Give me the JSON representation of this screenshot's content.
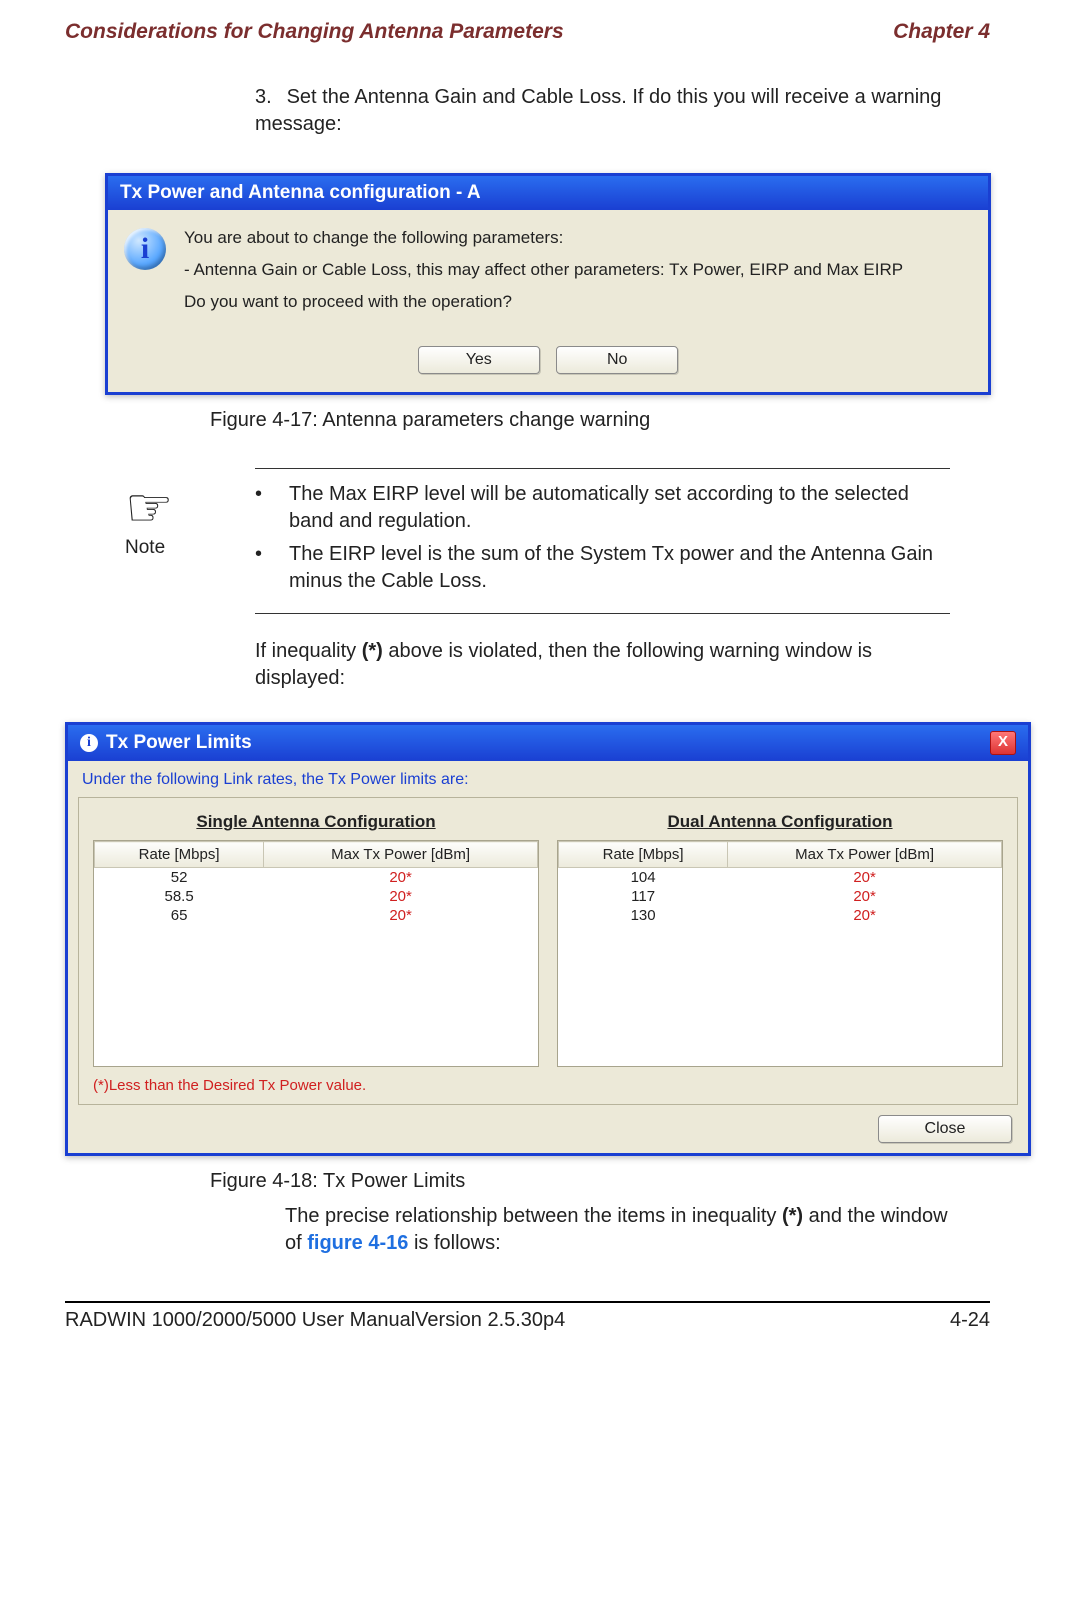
{
  "header": {
    "section_title": "Considerations for Changing Antenna Parameters",
    "chapter": "Chapter 4"
  },
  "step": {
    "number": "3.",
    "text": "Set the Antenna Gain and Cable Loss. If do this you will receive a warning message:"
  },
  "dialog1": {
    "title": "Tx Power and Antenna configuration - A",
    "line1": "You are about to change the following parameters:",
    "line2": "  - Antenna Gain or Cable Loss, this may affect other parameters: Tx Power, EIRP and Max EIRP",
    "line3": "Do you want to proceed with the operation?",
    "yes": "Yes",
    "no": "No"
  },
  "caption1": "Figure 4-17: Antenna parameters change warning",
  "note": {
    "label": "Note",
    "items": [
      "The Max EIRP level will be automatically set according to the selected band and regulation.",
      "The EIRP level is the sum of the System Tx power and the Antenna Gain minus the Cable Loss."
    ]
  },
  "after_note": {
    "pre": "If inequality ",
    "star": "(*)",
    "post": " above is violated, then the following warning window is displayed:"
  },
  "dialog2": {
    "title": "Tx Power Limits",
    "subhead": "Under the following Link rates, the Tx Power limits are:",
    "single_title": "Single Antenna Configuration",
    "dual_title": "Dual Antenna Configuration",
    "col_rate": "Rate [Mbps]",
    "col_pwr": "Max Tx Power [dBm]",
    "single": [
      {
        "rate": "52",
        "pwr": "20*"
      },
      {
        "rate": "58.5",
        "pwr": "20*"
      },
      {
        "rate": "65",
        "pwr": "20*"
      }
    ],
    "dual": [
      {
        "rate": "104",
        "pwr": "20*"
      },
      {
        "rate": "117",
        "pwr": "20*"
      },
      {
        "rate": "130",
        "pwr": "20*"
      }
    ],
    "footnote": "(*)Less than the Desired Tx Power value.",
    "close": "Close"
  },
  "caption2": "Figure 4-18: Tx Power Limits",
  "para": {
    "pre": "The precise relationship between the items in inequality ",
    "star": "(*)",
    "mid": " and the window of ",
    "link": "figure 4-16",
    "post": " is follows:"
  },
  "footer": {
    "left": "RADWIN 1000/2000/5000 User ManualVersion  2.5.30p4",
    "right": "4-24"
  }
}
